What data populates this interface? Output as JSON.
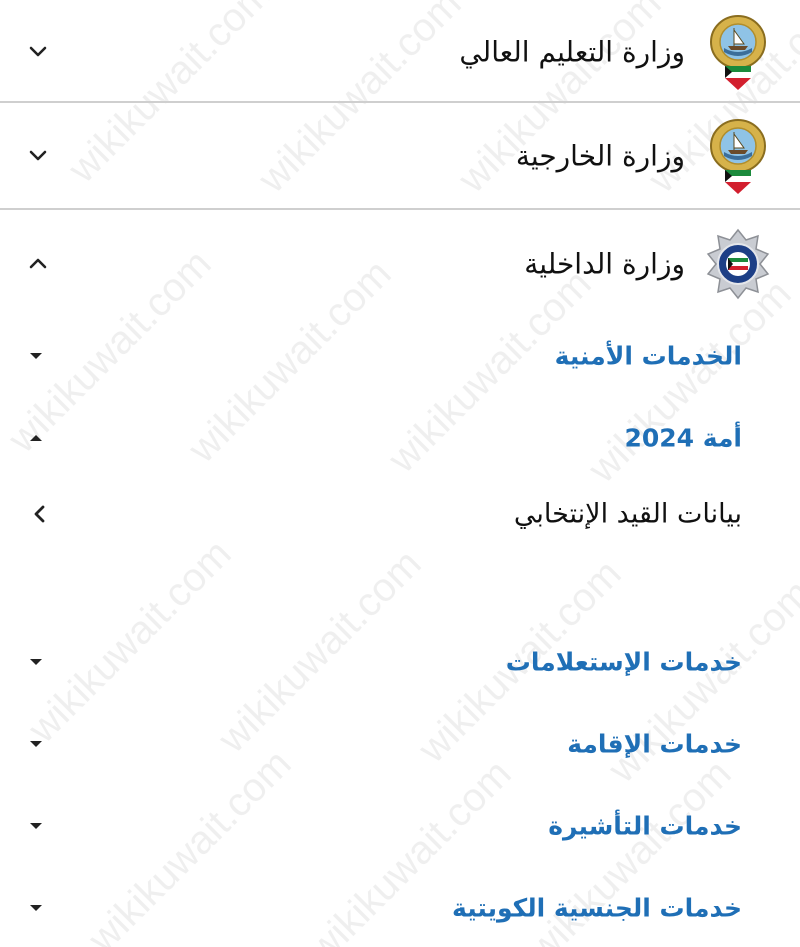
{
  "watermark": "wikikuwait.com",
  "ministries": [
    {
      "label": "وزارة التعليم العالي",
      "icon": "kuwait-emblem-icon",
      "expanded": false
    },
    {
      "label": "وزارة الخارجية",
      "icon": "kuwait-emblem-icon",
      "expanded": false
    },
    {
      "label": "وزارة الداخلية",
      "icon": "kuwait-police-badge-icon",
      "expanded": true
    }
  ],
  "interior_items": [
    {
      "label": "الخدمات الأمنية",
      "style": "section",
      "state": "collapsed"
    },
    {
      "label": "أمة 2024",
      "style": "section",
      "state": "expanded"
    },
    {
      "label": "بيانات القيد الإنتخابي",
      "style": "link",
      "state": "link"
    },
    {
      "label": "خدمات الإستعلامات",
      "style": "section",
      "state": "collapsed"
    },
    {
      "label": "خدمات الإقامة",
      "style": "section",
      "state": "collapsed"
    },
    {
      "label": "خدمات التأشيرة",
      "style": "section",
      "state": "collapsed"
    },
    {
      "label": "خدمات الجنسية الكويتية",
      "style": "section",
      "state": "collapsed"
    }
  ],
  "colors": {
    "section_label": "#1f6fb6",
    "text": "#111111",
    "divider": "#cfcfcf"
  }
}
